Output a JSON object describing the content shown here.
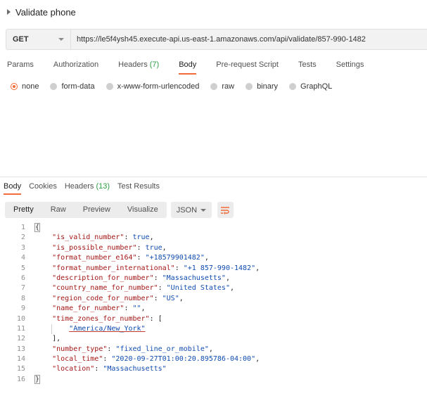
{
  "request": {
    "title": "Validate phone",
    "method": "GET",
    "url": "https://le5f4ysh45.execute-api.us-east-1.amazonaws.com/api/validate/857-990-1482"
  },
  "request_tabs": [
    {
      "label": "Params",
      "count": ""
    },
    {
      "label": "Authorization",
      "count": ""
    },
    {
      "label": "Headers",
      "count": "(7)"
    },
    {
      "label": "Body",
      "count": ""
    },
    {
      "label": "Pre-request Script",
      "count": ""
    },
    {
      "label": "Tests",
      "count": ""
    },
    {
      "label": "Settings",
      "count": ""
    }
  ],
  "active_request_tab": "Body",
  "body_types": [
    "none",
    "form-data",
    "x-www-form-urlencoded",
    "raw",
    "binary",
    "GraphQL"
  ],
  "selected_body_type": "none",
  "response_tabs": [
    {
      "label": "Body",
      "count": ""
    },
    {
      "label": "Cookies",
      "count": ""
    },
    {
      "label": "Headers",
      "count": "(13)"
    },
    {
      "label": "Test Results",
      "count": ""
    }
  ],
  "view_modes": [
    "Pretty",
    "Raw",
    "Preview",
    "Visualize"
  ],
  "active_view_mode": "Pretty",
  "format": "JSON",
  "colors": {
    "accent": "#f26b3a",
    "count": "#2e9e45",
    "key": "#a31515",
    "value": "#0f4bb0"
  },
  "response_lines": [
    {
      "n": "1",
      "parts": [
        [
          "p",
          "{"
        ]
      ],
      "box": true
    },
    {
      "n": "2",
      "parts": [
        [
          "p",
          "    "
        ],
        [
          "k",
          "\"is_valid_number\""
        ],
        [
          "p",
          ": "
        ],
        [
          "b",
          "true"
        ],
        [
          "p",
          ","
        ]
      ]
    },
    {
      "n": "3",
      "parts": [
        [
          "p",
          "    "
        ],
        [
          "k",
          "\"is_possible_number\""
        ],
        [
          "p",
          ": "
        ],
        [
          "b",
          "true"
        ],
        [
          "p",
          ","
        ]
      ]
    },
    {
      "n": "4",
      "parts": [
        [
          "p",
          "    "
        ],
        [
          "k",
          "\"format_number_e164\""
        ],
        [
          "p",
          ": "
        ],
        [
          "s",
          "\"+18579901482\""
        ],
        [
          "p",
          ","
        ]
      ]
    },
    {
      "n": "5",
      "parts": [
        [
          "p",
          "    "
        ],
        [
          "k",
          "\"format_number_international\""
        ],
        [
          "p",
          ": "
        ],
        [
          "s",
          "\"+1 857-990-1482\""
        ],
        [
          "p",
          ","
        ]
      ]
    },
    {
      "n": "6",
      "parts": [
        [
          "p",
          "    "
        ],
        [
          "k",
          "\"description_for_number\""
        ],
        [
          "p",
          ": "
        ],
        [
          "s",
          "\"Massachusetts\""
        ],
        [
          "p",
          ","
        ]
      ]
    },
    {
      "n": "7",
      "parts": [
        [
          "p",
          "    "
        ],
        [
          "k",
          "\"country_name_for_number\""
        ],
        [
          "p",
          ": "
        ],
        [
          "s",
          "\"United States\""
        ],
        [
          "p",
          ","
        ]
      ]
    },
    {
      "n": "8",
      "parts": [
        [
          "p",
          "    "
        ],
        [
          "k",
          "\"region_code_for_number\""
        ],
        [
          "p",
          ": "
        ],
        [
          "s",
          "\"US\""
        ],
        [
          "p",
          ","
        ]
      ]
    },
    {
      "n": "9",
      "parts": [
        [
          "p",
          "    "
        ],
        [
          "k",
          "\"name_for_number\""
        ],
        [
          "p",
          ": "
        ],
        [
          "s",
          "\"\""
        ],
        [
          "p",
          ","
        ]
      ]
    },
    {
      "n": "10",
      "parts": [
        [
          "p",
          "    "
        ],
        [
          "k",
          "\"time_zones_for_number\""
        ],
        [
          "p",
          ": ["
        ]
      ]
    },
    {
      "n": "11",
      "parts": [
        [
          "p",
          "        "
        ],
        [
          "s",
          "\"America/New_York\""
        ]
      ],
      "guide": true
    },
    {
      "n": "12",
      "parts": [
        [
          "p",
          "    ],"
        ]
      ]
    },
    {
      "n": "13",
      "parts": [
        [
          "p",
          "    "
        ],
        [
          "k",
          "\"number_type\""
        ],
        [
          "p",
          ": "
        ],
        [
          "s",
          "\"fixed_line_or_mobile\""
        ],
        [
          "p",
          ","
        ]
      ]
    },
    {
      "n": "14",
      "parts": [
        [
          "p",
          "    "
        ],
        [
          "k",
          "\"local_time\""
        ],
        [
          "p",
          ": "
        ],
        [
          "s",
          "\"2020-09-27T01:00:20.895786-04:00\""
        ],
        [
          "p",
          ","
        ]
      ]
    },
    {
      "n": "15",
      "parts": [
        [
          "p",
          "    "
        ],
        [
          "k",
          "\"location\""
        ],
        [
          "p",
          ": "
        ],
        [
          "s",
          "\"Massachusetts\""
        ]
      ]
    },
    {
      "n": "16",
      "parts": [
        [
          "p",
          "}"
        ]
      ],
      "box": true
    }
  ]
}
